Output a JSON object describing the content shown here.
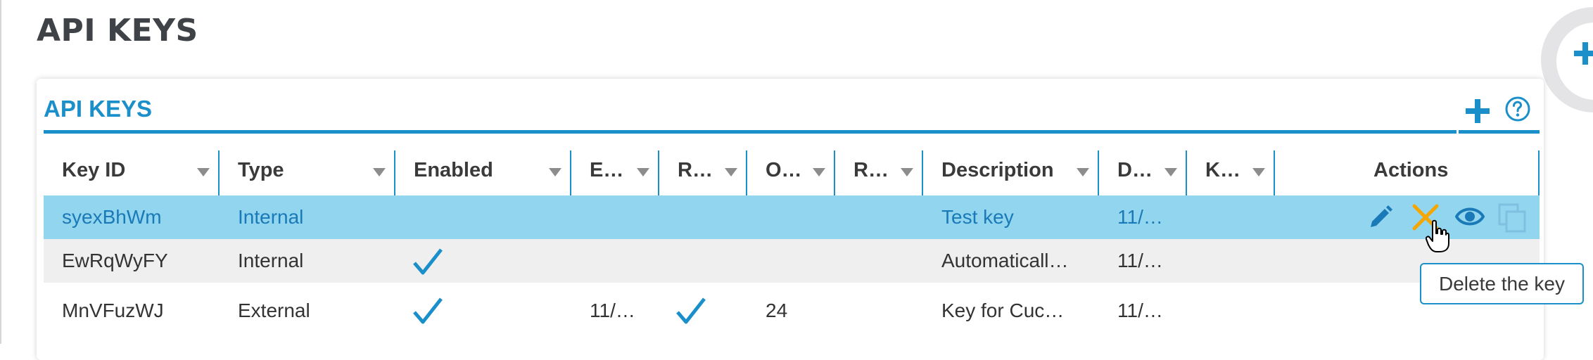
{
  "page": {
    "title": "API KEYS"
  },
  "panel": {
    "title": "API KEYS"
  },
  "colors": {
    "accent": "#1a8fc9",
    "selected_row": "#92d5ef",
    "alt_row": "#efefef",
    "delete_hover": "#f5a600"
  },
  "icons": {
    "fab": "plus-icon",
    "add": "plus-icon",
    "help": "question-circle-icon",
    "enabled": "check-icon",
    "edit": "pencil-icon",
    "delete": "close-icon",
    "view": "eye-icon",
    "copy": "copy-icon",
    "cursor": "hand-pointer-icon"
  },
  "table": {
    "columns": [
      {
        "key": "key_id",
        "label": "Key ID"
      },
      {
        "key": "type",
        "label": "Type"
      },
      {
        "key": "enabled",
        "label": "Enabled"
      },
      {
        "key": "e",
        "label": "E…"
      },
      {
        "key": "r1",
        "label": "R…"
      },
      {
        "key": "o",
        "label": "O…"
      },
      {
        "key": "r2",
        "label": "R…"
      },
      {
        "key": "description",
        "label": "Description"
      },
      {
        "key": "d",
        "label": "D…"
      },
      {
        "key": "k",
        "label": "K…"
      }
    ],
    "actions_label": "Actions",
    "rows": [
      {
        "key_id": "syexBhWm",
        "type": "Internal",
        "enabled": false,
        "e": "",
        "r1": false,
        "o": "",
        "r2": "",
        "description": "Test key",
        "d": "11/…",
        "k": "",
        "selected": true
      },
      {
        "key_id": "EwRqWyFY",
        "type": "Internal",
        "enabled": true,
        "e": "",
        "r1": false,
        "o": "",
        "r2": "",
        "description": "Automaticall…",
        "d": "11/…",
        "k": "",
        "selected": false
      },
      {
        "key_id": "MnVFuzWJ",
        "type": "External",
        "enabled": true,
        "e": "11/…",
        "r1": true,
        "o": "24",
        "r2": "",
        "description": "Key for Cuc…",
        "d": "11/…",
        "k": "",
        "selected": false
      }
    ]
  },
  "tooltip": {
    "text": "Delete the key"
  }
}
